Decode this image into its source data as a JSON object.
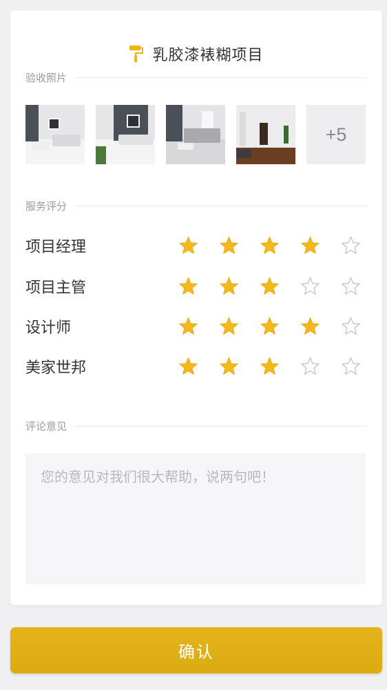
{
  "header": {
    "title": "乳胶漆裱糊项目",
    "icon": "paint-roller-icon"
  },
  "sections": {
    "photos_label": "验收照片",
    "rating_label": "服务评分",
    "comment_label": "评论意见"
  },
  "photos": {
    "more_label": "+5"
  },
  "ratings": [
    {
      "name": "项目经理",
      "stars": 4,
      "max": 5
    },
    {
      "name": "项目主管",
      "stars": 3,
      "max": 5
    },
    {
      "name": "设计师",
      "stars": 4,
      "max": 5
    },
    {
      "name": "美家世邦",
      "stars": 3,
      "max": 5
    }
  ],
  "comment": {
    "placeholder": "您的意见对我们很大帮助，说两句吧！",
    "value": ""
  },
  "confirm": {
    "label": "确认"
  },
  "colors": {
    "accent": "#e0af16",
    "star_filled": "#f5b81c",
    "star_empty": "#c8c8cc"
  }
}
